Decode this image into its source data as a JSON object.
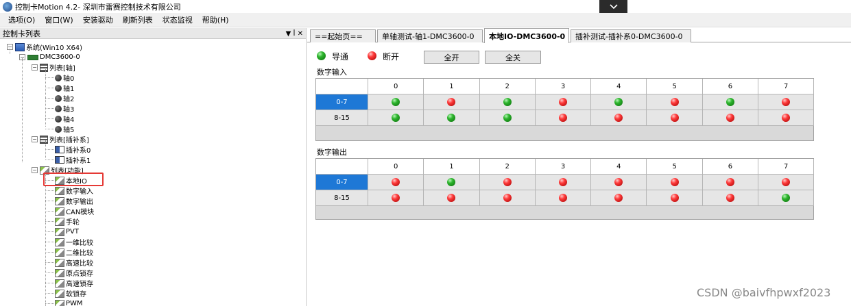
{
  "window": {
    "title": "控制卡Motion 4.2- 深圳市雷赛控制技术有限公司"
  },
  "menu": [
    {
      "label": "选项(O)"
    },
    {
      "label": "窗口(W)"
    },
    {
      "label": "安装驱动"
    },
    {
      "label": "刷新列表"
    },
    {
      "label": "状态监视"
    },
    {
      "label": "帮助(H)"
    }
  ],
  "left_panel": {
    "title": "控制卡列表",
    "pin_glyph": "▼ ꟾ ✕"
  },
  "tree": {
    "system": "系统(Win10 X64)",
    "card": "DMC3600-0",
    "axis_group": "列表[轴]",
    "axes": [
      "轴0",
      "轴1",
      "轴2",
      "轴3",
      "轴4",
      "轴5"
    ],
    "interp_group": "列表[插补系]",
    "interps": [
      "插补系0",
      "插补系1"
    ],
    "func_group": "列表[功能]",
    "funcs": [
      "本地IO",
      "数字输入",
      "数字输出",
      "CAN模块",
      "手轮",
      "PVT",
      "一维比较",
      "二维比较",
      "高速比较",
      "原点锁存",
      "高速锁存",
      "软锁存",
      "PWM"
    ]
  },
  "tabs": [
    {
      "label": "==起始页=="
    },
    {
      "label": "单轴测试-轴1-DMC3600-0"
    },
    {
      "label": "本地IO-DMC3600-0"
    },
    {
      "label": "插补测试-插补系0-DMC3600-0"
    }
  ],
  "legend": {
    "on_label": "导通",
    "off_label": "断开"
  },
  "buttons": {
    "all_on": "全开",
    "all_off": "全关"
  },
  "digital_input": {
    "label": "数字输入",
    "columns": [
      "0",
      "1",
      "2",
      "3",
      "4",
      "5",
      "6",
      "7"
    ],
    "rows": [
      {
        "label": "0-7",
        "selected": true,
        "states": [
          "on",
          "off",
          "on",
          "off",
          "on",
          "off",
          "on",
          "off"
        ]
      },
      {
        "label": "8-15",
        "selected": false,
        "states": [
          "on",
          "on",
          "on",
          "off",
          "off",
          "off",
          "off",
          "off"
        ]
      }
    ]
  },
  "digital_output": {
    "label": "数字输出",
    "columns": [
      "0",
      "1",
      "2",
      "3",
      "4",
      "5",
      "6",
      "7"
    ],
    "rows": [
      {
        "label": "0-7",
        "selected": true,
        "states": [
          "off",
          "on",
          "off",
          "off",
          "off",
          "off",
          "off",
          "off"
        ]
      },
      {
        "label": "8-15",
        "selected": false,
        "states": [
          "off",
          "off",
          "off",
          "off",
          "off",
          "off",
          "off",
          "on"
        ]
      }
    ]
  },
  "colors": {
    "selected_row": "#1e78d6",
    "highlight_box": "#e53935",
    "led_on": "#2db52d",
    "led_off": "#ff3b3b"
  },
  "watermark": "CSDN @baivfhpwxf2023"
}
